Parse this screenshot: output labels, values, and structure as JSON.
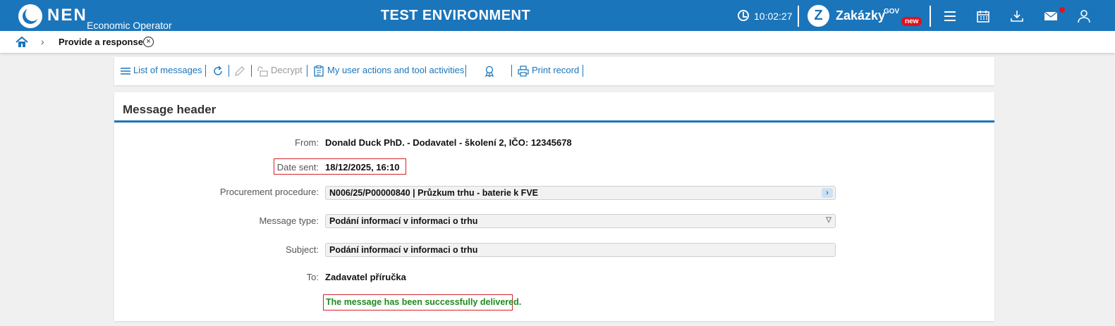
{
  "header": {
    "logo_text": "NEN",
    "logo_sub": "Economic Operator",
    "environment": "TEST ENVIRONMENT",
    "time": "10:02:27",
    "zakazky": "Zakázky",
    "gov": "GOV",
    "new_badge": "new"
  },
  "breadcrumb": {
    "current": "Provide a response",
    "close_symbol": "×"
  },
  "toolbar": {
    "list_of_messages": "List of messages",
    "decrypt": "Decrypt",
    "my_actions": "My user actions and tool activities",
    "print_record": "Print record"
  },
  "message_header": {
    "title": "Message header",
    "from_label": "From:",
    "from_value": "Donald Duck PhD. - Dodavatel - školení 2, IČO: 12345678",
    "date_label": "Date sent:",
    "date_value": "18/12/2025, 16:10",
    "procedure_label": "Procurement procedure:",
    "procedure_value": "N006/25/P00000840 | Průzkum trhu - baterie k FVE",
    "type_label": "Message type:",
    "type_value": "Podání informací v informaci o trhu",
    "subject_label": "Subject:",
    "subject_value": "Podání informací v informaci o trhu",
    "to_label": "To:",
    "to_value": "Zadavatel příručka",
    "status": "The message has been successfully delivered."
  },
  "colors": {
    "brand_blue": "#1b75bb",
    "highlight_red": "#d2232a",
    "success_green": "#1f8a1f",
    "badge_red": "#e3111b"
  }
}
